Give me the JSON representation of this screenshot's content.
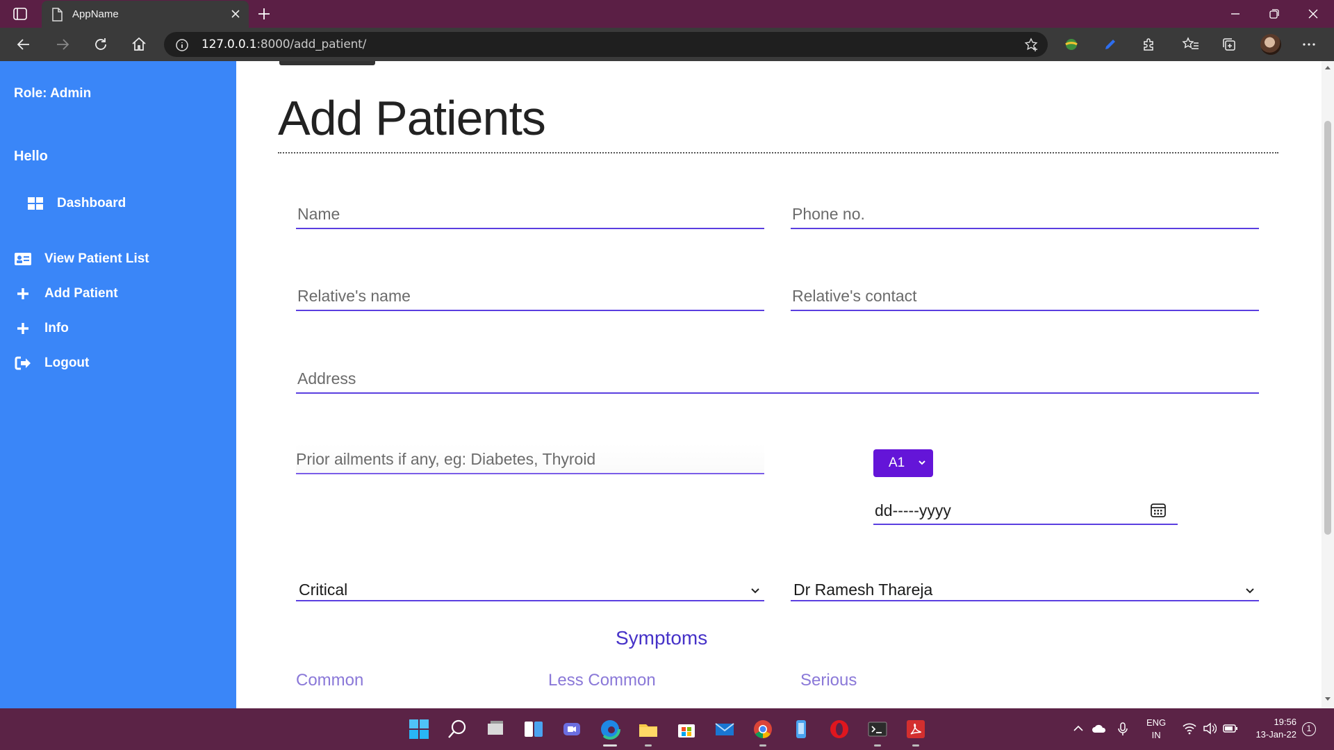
{
  "browser": {
    "tab_title": "AppName",
    "url_host": "127.0.0.1",
    "url_path": ":8000/add_patient/"
  },
  "sidebar": {
    "role": "Role: Admin",
    "greeting": "Hello",
    "items": [
      {
        "label": "Dashboard",
        "icon": "dashboard-grid-icon"
      },
      {
        "label": "View Patient List",
        "icon": "id-card-icon"
      },
      {
        "label": "Add Patient",
        "icon": "plus-icon"
      },
      {
        "label": "Info",
        "icon": "plus-icon"
      },
      {
        "label": "Logout",
        "icon": "logout-icon"
      }
    ],
    "color": "#3a86f8"
  },
  "form": {
    "title": "Add Patients",
    "name_placeholder": "Name",
    "phone_placeholder": "Phone no.",
    "relative_name_placeholder": "Relative's name",
    "relative_contact_placeholder": "Relative's contact",
    "address_placeholder": "Address",
    "ailments_placeholder": "Prior ailments if any, eg: Diabetes, Thyroid",
    "blood_group": "A1",
    "date_placeholder": "dd-----yyyy",
    "condition": "Critical",
    "doctor": "Dr Ramesh Thareja",
    "accent_color": "#5a3ee0",
    "button_color": "#6415d8"
  },
  "symptoms": {
    "heading": "Symptoms",
    "columns": [
      "Common",
      "Less Common",
      "Serious"
    ]
  },
  "taskbar": {
    "lang_line1": "ENG",
    "lang_line2": "IN",
    "time": "19:56",
    "date": "13-Jan-22",
    "notifications": "1"
  }
}
